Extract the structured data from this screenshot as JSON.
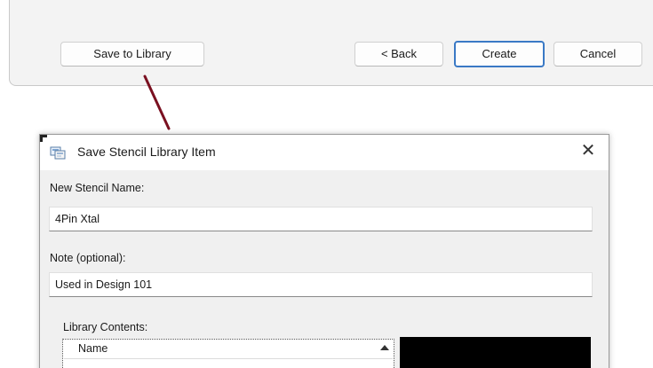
{
  "wizard": {
    "save_to_library_label": "Save to Library",
    "back_label": "< Back",
    "create_label": "Create",
    "cancel_label": "Cancel"
  },
  "dialog": {
    "title": "Save Stencil Library Item",
    "close_icon": "close-icon",
    "title_icon": "stencil-library-icon",
    "stencil_name_label": "New Stencil Name:",
    "stencil_name_value": "4Pin Xtal",
    "note_label": "Note (optional):",
    "note_value": "Used in Design 101",
    "library_contents_label": "Library Contents:",
    "library_table": {
      "columns": [
        "Name"
      ],
      "sort_direction": "ascending",
      "rows": []
    }
  },
  "colors": {
    "pointer_line": "#7a1020",
    "create_button_border": "#3a79c5",
    "preview_background": "#000000"
  }
}
